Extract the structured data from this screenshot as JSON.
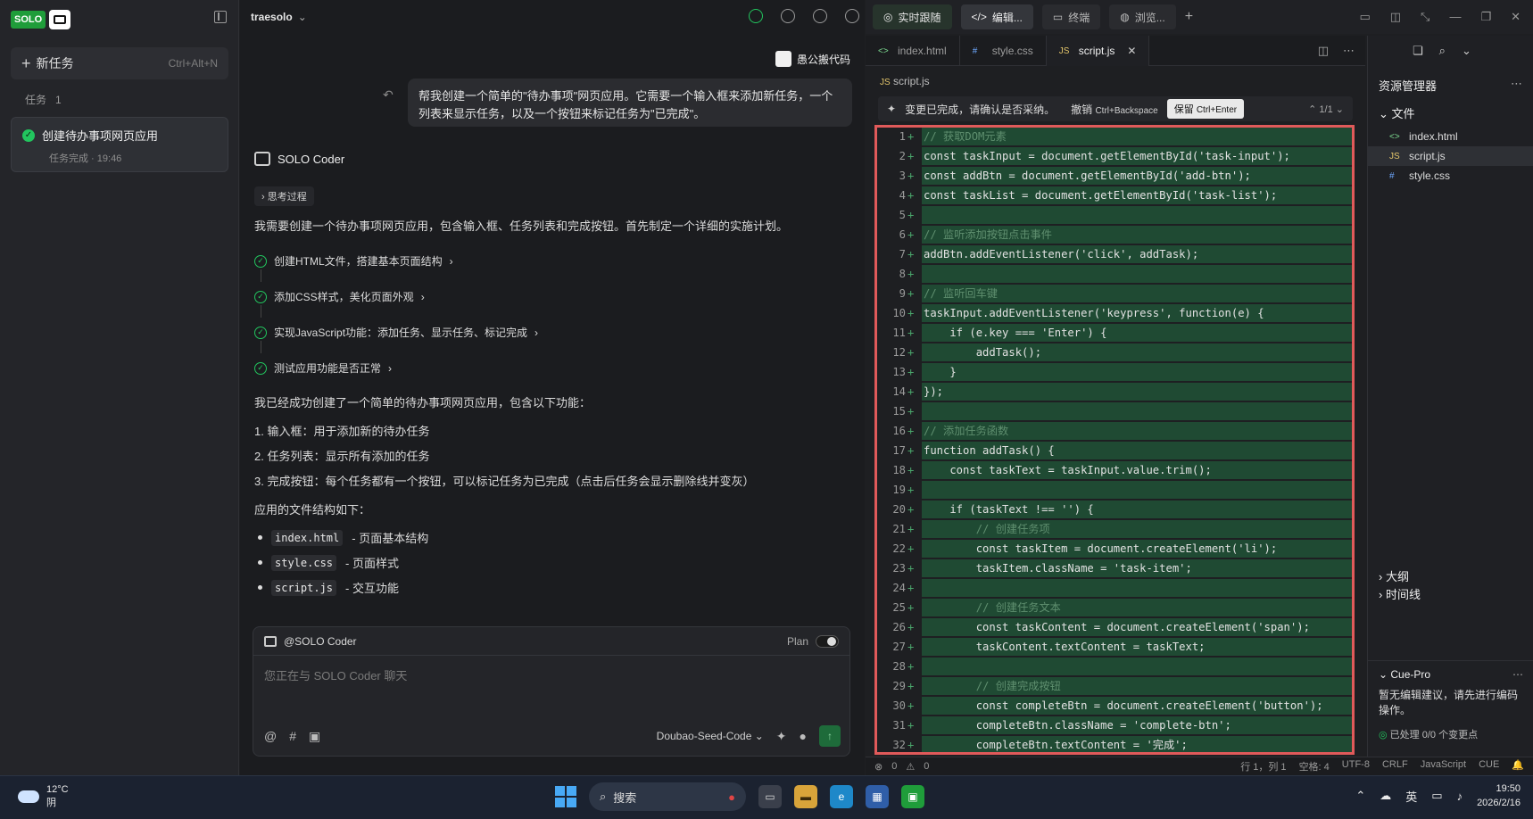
{
  "sidebar": {
    "logo_text": "SOLO",
    "new_task_label": "新任务",
    "new_task_shortcut": "Ctrl+Alt+N",
    "tasks_header": "任务",
    "tasks_count": "1",
    "task": {
      "title": "创建待办事项网页应用",
      "subtitle": "任务完成 · 19:46"
    }
  },
  "chat": {
    "workspace": "traesolo",
    "user_name": "愚公搬代码",
    "user_message": "帮我创建一个简单的\"待办事项\"网页应用。它需要一个输入框来添加新任务，一个列表来显示任务，以及一个按钮来标记任务为\"已完成\"。",
    "agent_name": "SOLO Coder",
    "thinking_label": "思考过程",
    "intro": "我需要创建一个待办事项网页应用，包含输入框、任务列表和完成按钮。首先制定一个详细的实施计划。",
    "steps": [
      "创建HTML文件，搭建基本页面结构",
      "添加CSS样式，美化页面外观",
      "实现JavaScript功能：添加任务、显示任务、标记完成",
      "测试应用功能是否正常"
    ],
    "summary": "我已经成功创建了一个简单的待办事项网页应用，包含以下功能：",
    "features": [
      "1. 输入框：用于添加新的待办任务",
      "2. 任务列表：显示所有添加的任务",
      "3. 完成按钮：每个任务都有一个按钮，可以标记任务为已完成（点击后任务会显示删除线并变灰）"
    ],
    "structure_label": "应用的文件结构如下：",
    "files": [
      {
        "name": "index.html",
        "desc": "- 页面基本结构"
      },
      {
        "name": "style.css",
        "desc": "- 页面样式"
      },
      {
        "name": "script.js",
        "desc": "- 交互功能"
      }
    ],
    "input": {
      "mention": "@SOLO Coder",
      "plan_label": "Plan",
      "placeholder": "您正在与 SOLO Coder 聊天",
      "model": "Doubao-Seed-Code"
    }
  },
  "editor": {
    "top_tabs": [
      "实时跟随",
      "编辑...",
      "终端",
      "浏览..."
    ],
    "tabs": [
      "index.html",
      "style.css",
      "script.js"
    ],
    "breadcrumb": "script.js",
    "change_notice": "变更已完成，请确认是否采纳。",
    "revoke_label": "撤销",
    "revoke_shortcut": "Ctrl+Backspace",
    "keep_label": "保留",
    "keep_shortcut": "Ctrl+Enter",
    "change_nav": "1/1",
    "lines": [
      "// 获取DOM元素",
      "const taskInput = document.getElementById('task-input');",
      "const addBtn = document.getElementById('add-btn');",
      "const taskList = document.getElementById('task-list');",
      "",
      "// 监听添加按钮点击事件",
      "addBtn.addEventListener('click', addTask);",
      "",
      "// 监听回车键",
      "taskInput.addEventListener('keypress', function(e) {",
      "    if (e.key === 'Enter') {",
      "        addTask();",
      "    }",
      "});",
      "",
      "// 添加任务函数",
      "function addTask() {",
      "    const taskText = taskInput.value.trim();",
      "",
      "    if (taskText !== '') {",
      "        // 创建任务项",
      "        const taskItem = document.createElement('li');",
      "        taskItem.className = 'task-item';",
      "",
      "        // 创建任务文本",
      "        const taskContent = document.createElement('span');",
      "        taskContent.textContent = taskText;",
      "",
      "        // 创建完成按钮",
      "        const completeBtn = document.createElement('button');",
      "        completeBtn.className = 'complete-btn';",
      "        completeBtn.textContent = '完成';"
    ],
    "status": {
      "errors": "0",
      "warnings": "0",
      "position": "行 1，列 1",
      "spaces": "空格: 4",
      "encoding": "UTF-8",
      "eol": "CRLF",
      "language": "JavaScript",
      "cue": "CUE"
    }
  },
  "explorer": {
    "title": "资源管理器",
    "folder": "文件",
    "files": [
      "index.html",
      "script.js",
      "style.css"
    ],
    "outline": "大纲",
    "timeline": "时间线",
    "cue_title": "Cue-Pro",
    "cue_desc": "暂无编辑建议，请先进行编码操作。",
    "cue_done": "已处理 0/0 个变更点"
  },
  "taskbar": {
    "temp": "12°C",
    "weather": "阴",
    "search": "搜索",
    "ime": "英",
    "time": "19:50",
    "date": "2026/2/16"
  }
}
